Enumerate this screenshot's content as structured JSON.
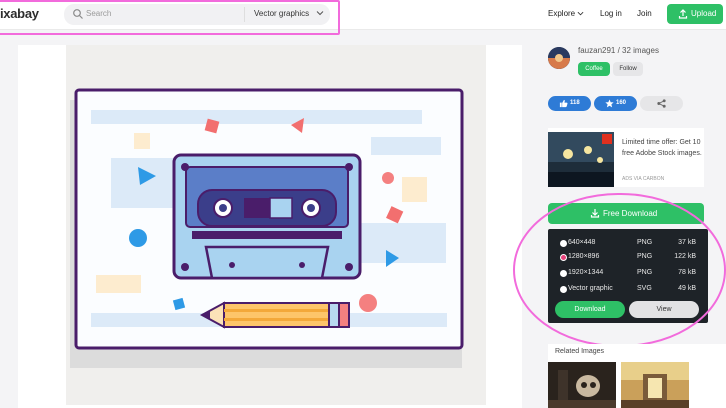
{
  "header": {
    "logo": "ixabay",
    "search_placeholder": "Search",
    "media_type": "Vector graphics",
    "nav_explore": "Explore",
    "nav_login": "Log in",
    "nav_join": "Join",
    "upload": "Upload"
  },
  "author": {
    "name_line": "fauzan291 / 32 images",
    "coffee": "Coffee",
    "follow": "Follow"
  },
  "stats": {
    "likes": "118",
    "favorites": "160"
  },
  "ad": {
    "text": "Limited time offer: Get 10 free Adobe Stock images.",
    "via": "ADS VIA CARBON"
  },
  "download": {
    "button": "Free Download",
    "options": [
      {
        "res": "640×448",
        "format": "PNG",
        "size": "37 kB",
        "selected": false
      },
      {
        "res": "1280×896",
        "format": "PNG",
        "size": "122 kB",
        "selected": true
      },
      {
        "res": "1920×1344",
        "format": "PNG",
        "size": "78 kB",
        "selected": false
      },
      {
        "res": "Vector graphic",
        "format": "SVG",
        "size": "49 kB",
        "selected": false
      }
    ],
    "download_label": "Download",
    "view_label": "View"
  },
  "related": {
    "title": "Related Images"
  },
  "colors": {
    "accent_green": "#2ec066",
    "like_blue": "#2e7bd6",
    "highlight_pink": "#f26bdc",
    "dropdown_bg": "#1e2328"
  }
}
